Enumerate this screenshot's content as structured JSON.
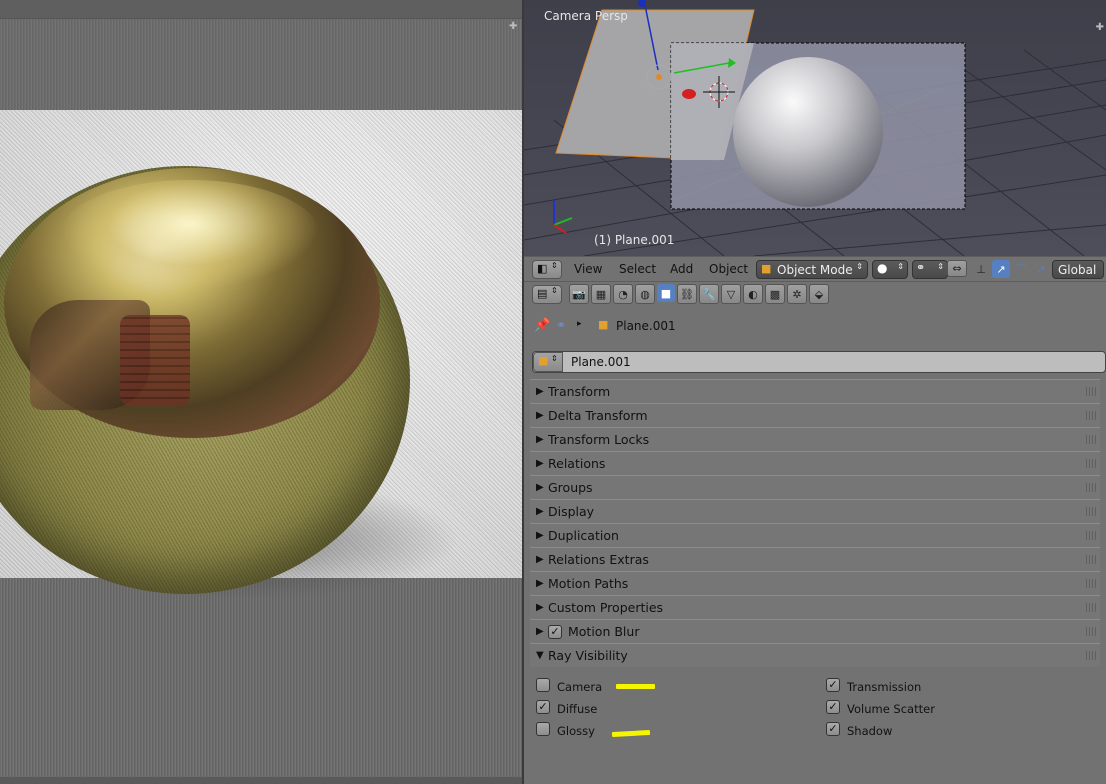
{
  "viewport": {
    "view_label": "Camera Persp",
    "object_label": "(1) Plane.001"
  },
  "header": {
    "menus": [
      "View",
      "Select",
      "Add",
      "Object"
    ],
    "mode": "Object Mode",
    "orientation": "Global"
  },
  "properties": {
    "object_name": "Plane.001",
    "breadcrumb_object": "Plane.001",
    "panels": [
      {
        "label": "Transform",
        "expanded": false
      },
      {
        "label": "Delta Transform",
        "expanded": false
      },
      {
        "label": "Transform Locks",
        "expanded": false
      },
      {
        "label": "Relations",
        "expanded": false
      },
      {
        "label": "Groups",
        "expanded": false
      },
      {
        "label": "Display",
        "expanded": false
      },
      {
        "label": "Duplication",
        "expanded": false
      },
      {
        "label": "Relations Extras",
        "expanded": false
      },
      {
        "label": "Motion Paths",
        "expanded": false
      },
      {
        "label": "Custom Properties",
        "expanded": false
      },
      {
        "label": "Motion Blur",
        "expanded": false,
        "checked": true
      },
      {
        "label": "Ray Visibility",
        "expanded": true
      }
    ],
    "ray_visibility": {
      "left": [
        {
          "label": "Camera",
          "checked": false,
          "highlighted": true
        },
        {
          "label": "Diffuse",
          "checked": true,
          "highlighted": false
        },
        {
          "label": "Glossy",
          "checked": false,
          "highlighted": true
        }
      ],
      "right": [
        {
          "label": "Transmission",
          "checked": true
        },
        {
          "label": "Volume Scatter",
          "checked": true
        },
        {
          "label": "Shadow",
          "checked": true
        }
      ]
    }
  },
  "colors": {
    "accent": "#5680c2",
    "highlight_marker": "#f5f500",
    "panel_bg": "#727272"
  },
  "icons": {
    "checkmark": "✓",
    "collapsed": "▶",
    "expanded": "▼"
  }
}
